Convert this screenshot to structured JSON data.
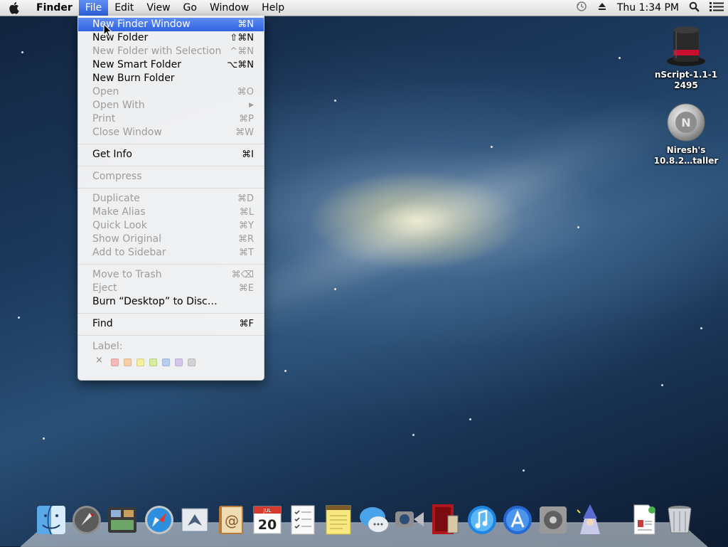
{
  "menubar": {
    "apple": "apple-icon",
    "items": [
      {
        "label": "Finder"
      },
      {
        "label": "File"
      },
      {
        "label": "Edit"
      },
      {
        "label": "View"
      },
      {
        "label": "Go"
      },
      {
        "label": "Window"
      },
      {
        "label": "Help"
      }
    ],
    "clock": "Thu 1:34 PM",
    "status_icons": [
      "time-machine-icon",
      "eject-icon",
      "spotlight-icon",
      "notification-center-icon"
    ]
  },
  "file_menu": {
    "items": [
      {
        "label": "New Finder Window",
        "shortcut": "⌘N"
      },
      {
        "label": "New Folder",
        "shortcut": "⇧⌘N"
      },
      {
        "label": "New Folder with Selection",
        "shortcut": "^⌘N"
      },
      {
        "label": "New Smart Folder",
        "shortcut": "⌥⌘N"
      },
      {
        "label": "New Burn Folder",
        "shortcut": ""
      },
      {
        "label": "Open",
        "shortcut": "⌘O"
      },
      {
        "label": "Open With",
        "shortcut": "▶"
      },
      {
        "label": "Print",
        "shortcut": "⌘P"
      },
      {
        "label": "Close Window",
        "shortcut": "⌘W"
      },
      {
        "label": "Get Info",
        "shortcut": "⌘I"
      },
      {
        "label": "Compress",
        "shortcut": ""
      },
      {
        "label": "Duplicate",
        "shortcut": "⌘D"
      },
      {
        "label": "Make Alias",
        "shortcut": "⌘L"
      },
      {
        "label": "Quick Look",
        "shortcut": "⌘Y"
      },
      {
        "label": "Show Original",
        "shortcut": "⌘R"
      },
      {
        "label": "Add to Sidebar",
        "shortcut": "⌘T"
      },
      {
        "label": "Move to Trash",
        "shortcut": "⌘⌫"
      },
      {
        "label": "Eject",
        "shortcut": "⌘E"
      },
      {
        "label": "Burn “Desktop” to Disc…",
        "shortcut": ""
      },
      {
        "label": "Find",
        "shortcut": "⌘F"
      }
    ],
    "label_title": "Label:",
    "label_clear": "×",
    "label_colors": [
      "#f4b9b9",
      "#f7cfa6",
      "#f4ee9e",
      "#d6ec9f",
      "#b6cff0",
      "#d5c6ec",
      "#d2d2d2"
    ],
    "highlight_color": "#3a6de4"
  },
  "desktop_icons": [
    {
      "label_line1": "nScript-1.1-1",
      "label_line2": "2495",
      "icon": "top-hat-icon"
    },
    {
      "label_line1": "Niresh's",
      "label_line2": "10.8.2…taller",
      "icon": "installer-disc-icon"
    }
  ],
  "dock": {
    "apps": [
      "finder-icon",
      "launchpad-icon",
      "mission-control-icon",
      "safari-icon",
      "mail-icon",
      "contacts-icon",
      "calendar-icon",
      "reminders-icon",
      "notes-icon",
      "messages-icon",
      "facetime-icon",
      "photo-booth-icon",
      "itunes-icon",
      "app-store-icon",
      "system-preferences-icon",
      "wizard-icon",
      "document-icon",
      "trash-icon"
    ],
    "calendar_day": "20",
    "calendar_month": "JUL"
  }
}
